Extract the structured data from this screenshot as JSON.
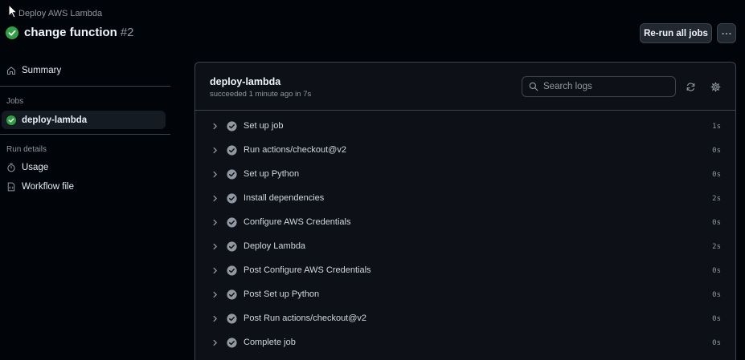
{
  "header": {
    "workflow_name": "Deploy AWS Lambda",
    "run_title": "change function",
    "run_number": "#2",
    "rerun_label": "Re-run all jobs"
  },
  "sidebar": {
    "summary_label": "Summary",
    "jobs_heading": "Jobs",
    "jobs": [
      {
        "label": "deploy-lambda",
        "status": "success"
      }
    ],
    "run_details_heading": "Run details",
    "usage_label": "Usage",
    "workflow_file_label": "Workflow file"
  },
  "job": {
    "name": "deploy-lambda",
    "status_text": "succeeded 1 minute ago in 7s",
    "search_placeholder": "Search logs",
    "steps": [
      {
        "label": "Set up job",
        "duration": "1s"
      },
      {
        "label": "Run actions/checkout@v2",
        "duration": "0s"
      },
      {
        "label": "Set up Python",
        "duration": "0s"
      },
      {
        "label": "Install dependencies",
        "duration": "2s"
      },
      {
        "label": "Configure AWS Credentials",
        "duration": "0s"
      },
      {
        "label": "Deploy Lambda",
        "duration": "2s"
      },
      {
        "label": "Post Configure AWS Credentials",
        "duration": "0s"
      },
      {
        "label": "Post Set up Python",
        "duration": "0s"
      },
      {
        "label": "Post Run actions/checkout@v2",
        "duration": "0s"
      },
      {
        "label": "Complete job",
        "duration": "0s"
      }
    ]
  },
  "colors": {
    "success": "#238636",
    "step_check": "#9198a1",
    "background": "#010409",
    "panel": "#0d1117",
    "border": "#3d444d"
  },
  "icons": {
    "status": "check-circle-fill-icon",
    "step_status": "check-circle-icon",
    "expand": "chevron-right-icon",
    "summary": "home-icon",
    "usage": "stopwatch-icon",
    "workflow_file": "file-code-icon",
    "search": "search-icon",
    "refresh": "sync-icon",
    "settings": "gear-icon",
    "more": "kebab-horizontal-icon"
  }
}
